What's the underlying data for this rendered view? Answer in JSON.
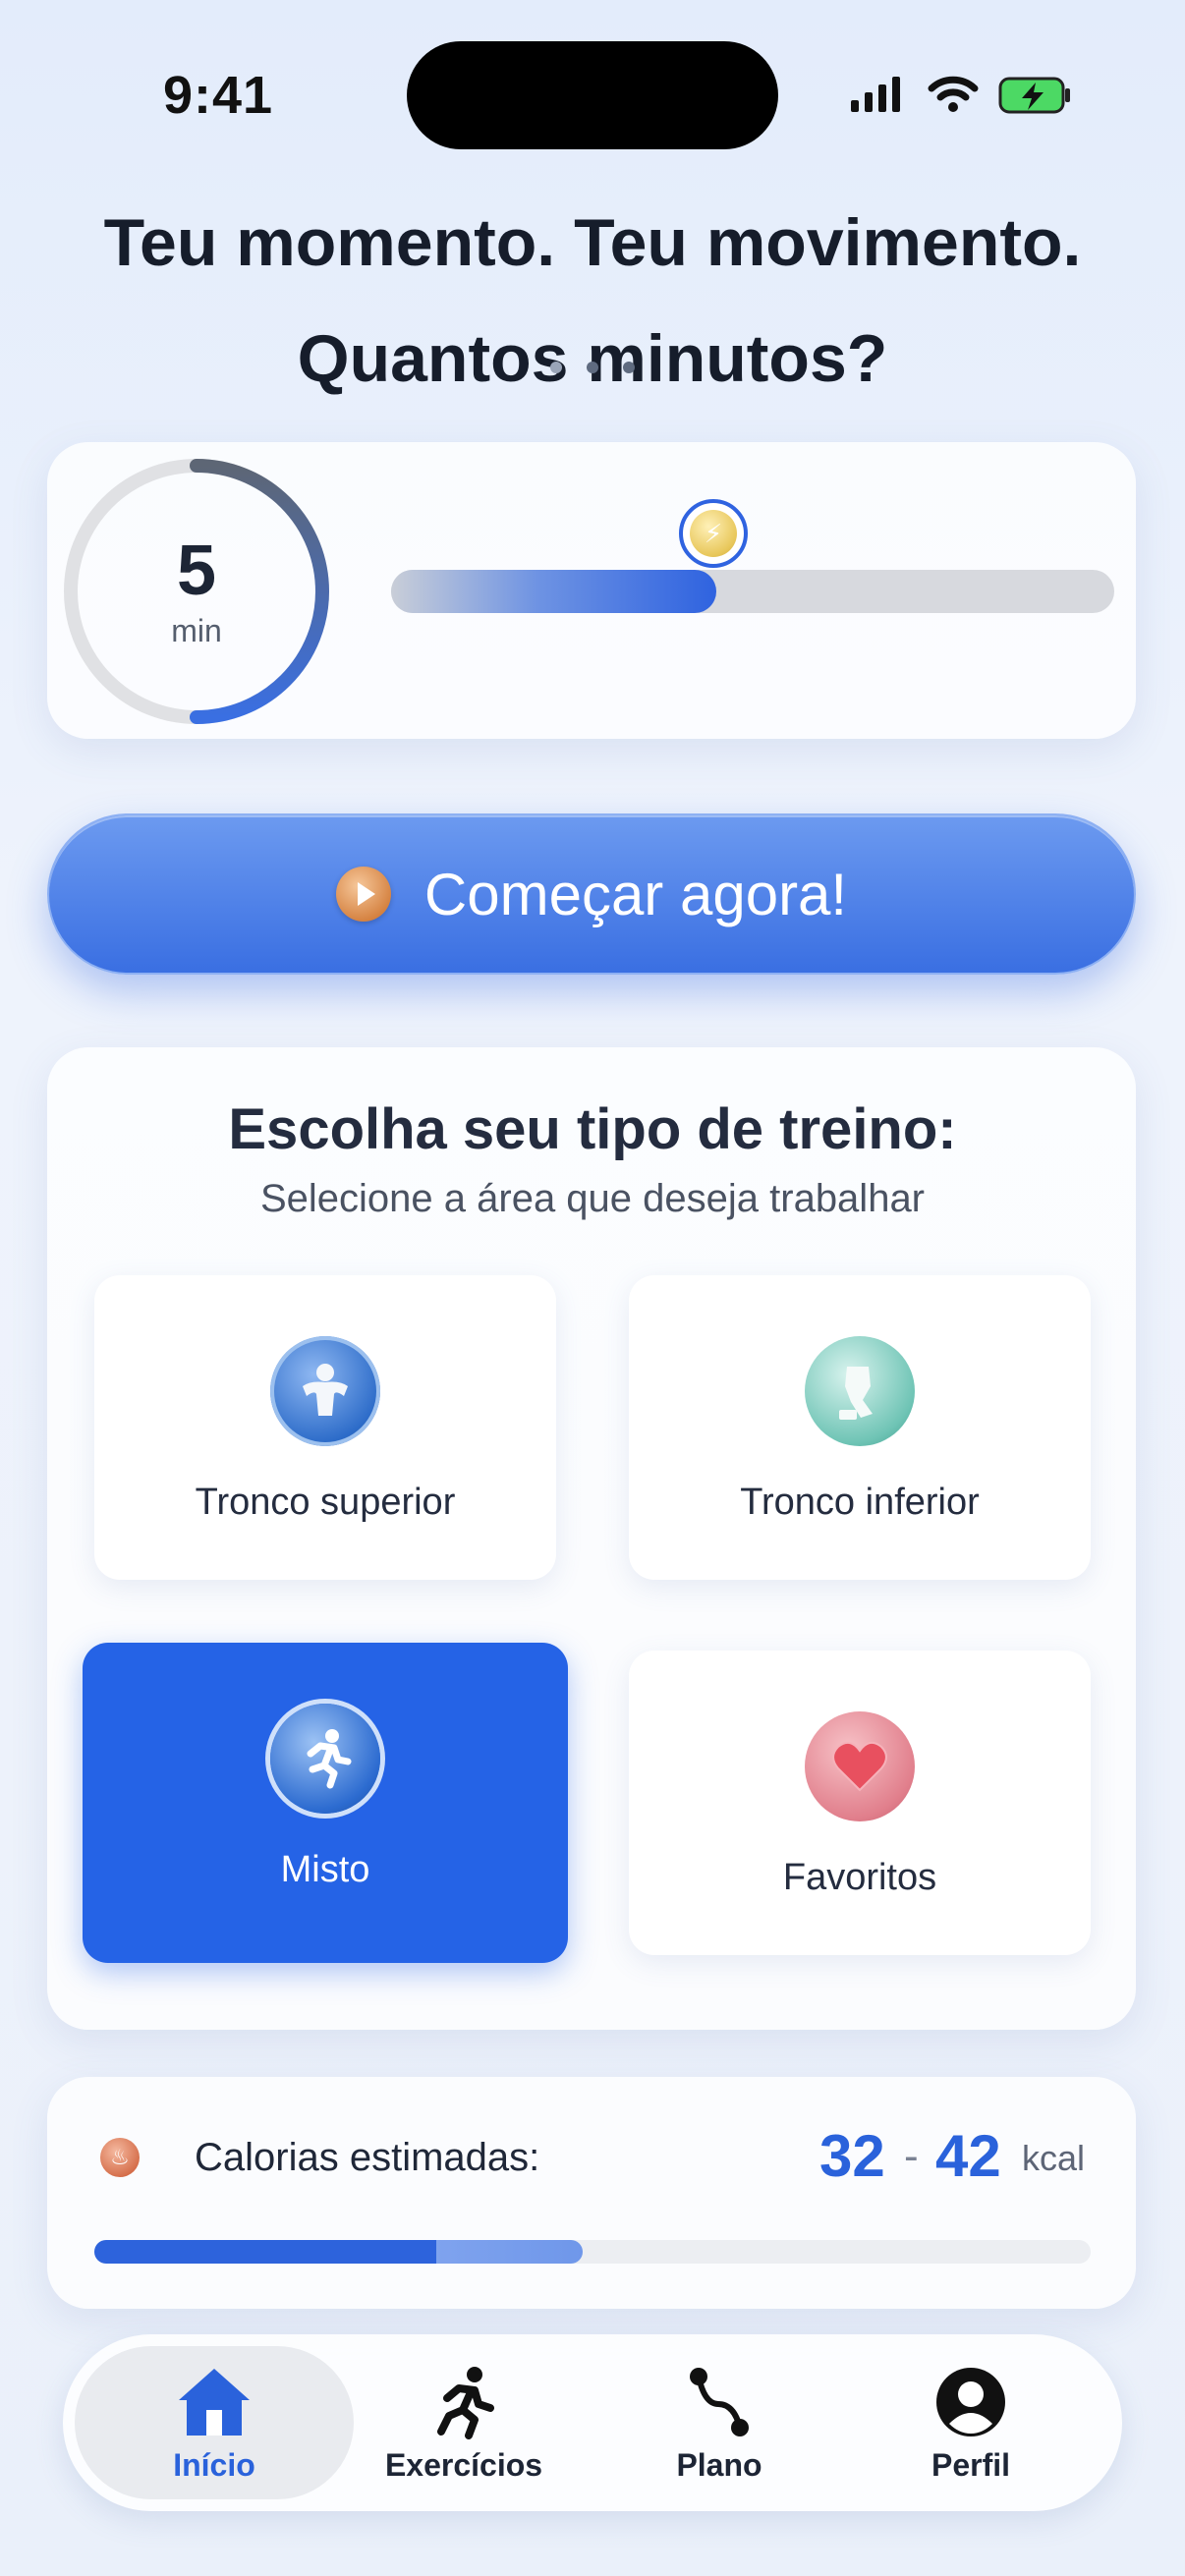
{
  "status_bar": {
    "time": "9:41"
  },
  "header": {
    "line1": "Teu momento. Teu movimento.",
    "line2": "Quantos minutos?"
  },
  "timer": {
    "value": "5",
    "unit": "min",
    "slider_fraction": 0.45,
    "dial_fraction": 0.5
  },
  "start_button": {
    "label": "Começar agora!"
  },
  "workout_section": {
    "title": "Escolha seu tipo de treino:",
    "subtitle": "Selecione a área que deseja trabalhar",
    "options": [
      {
        "label": "Tronco superior",
        "icon": "upper-body-icon",
        "selected": false
      },
      {
        "label": "Tronco inferior",
        "icon": "lower-body-icon",
        "selected": false
      },
      {
        "label": "Misto",
        "icon": "running-icon",
        "selected": true
      },
      {
        "label": "Favoritos",
        "icon": "heart-icon",
        "selected": false
      }
    ]
  },
  "calories": {
    "label": "Calorias estimadas:",
    "low": "32",
    "high": "42",
    "separator": "-",
    "unit": "kcal",
    "progress_fraction": 0.49
  },
  "tab_bar": {
    "items": [
      {
        "label": "Início",
        "icon": "home-icon",
        "active": true
      },
      {
        "label": "Exercícios",
        "icon": "runner-icon",
        "active": false
      },
      {
        "label": "Plano",
        "icon": "route-icon",
        "active": false
      },
      {
        "label": "Perfil",
        "icon": "profile-icon",
        "active": false
      }
    ]
  },
  "colors": {
    "accent": "#2563e6",
    "calorie_value": "#2a62db"
  }
}
